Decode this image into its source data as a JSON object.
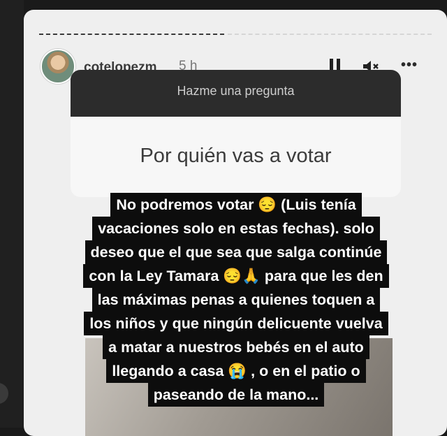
{
  "story": {
    "username": "cotelopezm",
    "time_ago": "5 h"
  },
  "controls": {
    "pause_icon": "pause-icon",
    "mute_icon": "mute-icon",
    "more_glyph": "•••"
  },
  "question_box": {
    "prompt": "Hazme una pregunta",
    "question": "Por quién vas a votar"
  },
  "caption_lines": [
    "No podremos votar 😔 (Luis tenía",
    "vacaciones solo en estas fechas). solo",
    "deseo que el que sea que salga continúe",
    "con la Ley Tamara 😔🙏 para que les den",
    "las máximas penas a quienes toquen a",
    "los niños y que ningún delicuente vuelva",
    "a matar a nuestros bebés en el auto",
    "llegando a casa 😭 , o en el patio o",
    "paseando de la mano..."
  ],
  "colors": {
    "story_bg": "#efefef",
    "question_header": "#2c2c2c",
    "caption_bg": "#0d0d0d"
  }
}
